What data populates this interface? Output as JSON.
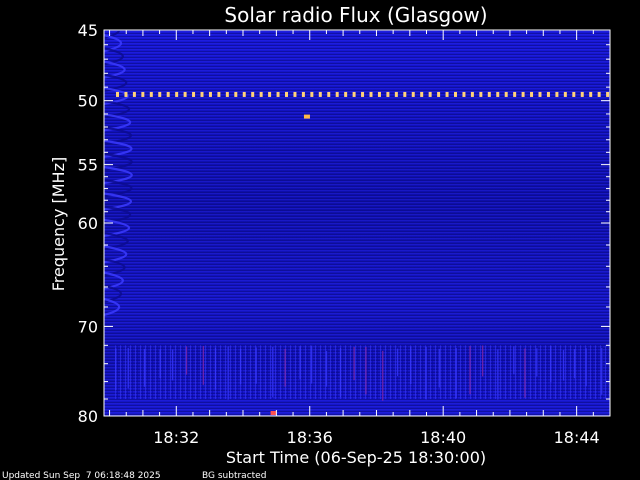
{
  "chart_data": {
    "type": "heatmap",
    "title": "Solar radio Flux (Glasgow)",
    "xlabel": "Start Time (06-Sep-25 18:30:00)",
    "ylabel": "Frequency [MHz]",
    "x_axis": {
      "unit": "time",
      "range": [
        "18:29:50",
        "18:45:00"
      ],
      "major_ticks": [
        "18:32",
        "18:36",
        "18:40",
        "18:44"
      ]
    },
    "y_axis": {
      "unit": "MHz",
      "range": [
        45,
        80
      ],
      "inverted": true,
      "scale": "log",
      "major_ticks": [
        45,
        50,
        55,
        60,
        70,
        80
      ]
    },
    "features": [
      {
        "kind": "continuous interference line",
        "frequency_mhz": 49.5,
        "color": "#ffd27a"
      },
      {
        "kind": "isolated burst",
        "time": "18:35:55",
        "frequency_mhz": 51.2,
        "color": "#ffb84a"
      },
      {
        "kind": "isolated burst",
        "time": "18:34:55",
        "frequency_mhz": 80,
        "color": "#ff5050"
      },
      {
        "kind": "drifting wave pattern",
        "time_start": "18:30:20",
        "time_end": "18:31:30",
        "frequency_range_mhz": [
          45,
          68
        ]
      },
      {
        "kind": "vertical striations",
        "frequency_range_mhz": [
          72,
          78
        ],
        "time_range": [
          "18:30:10",
          "18:45:00"
        ]
      }
    ],
    "colors": {
      "background": "#000000",
      "plot_base": "#1414c8",
      "plot_dark": "#0a0a8c",
      "plot_light": "#2a2aee",
      "axis": "#ffffff",
      "hot": "#ffd27a"
    }
  },
  "footer": {
    "updated": "Updated Sun Sep  7 06:18:48 2025",
    "note": "BG subtracted"
  }
}
